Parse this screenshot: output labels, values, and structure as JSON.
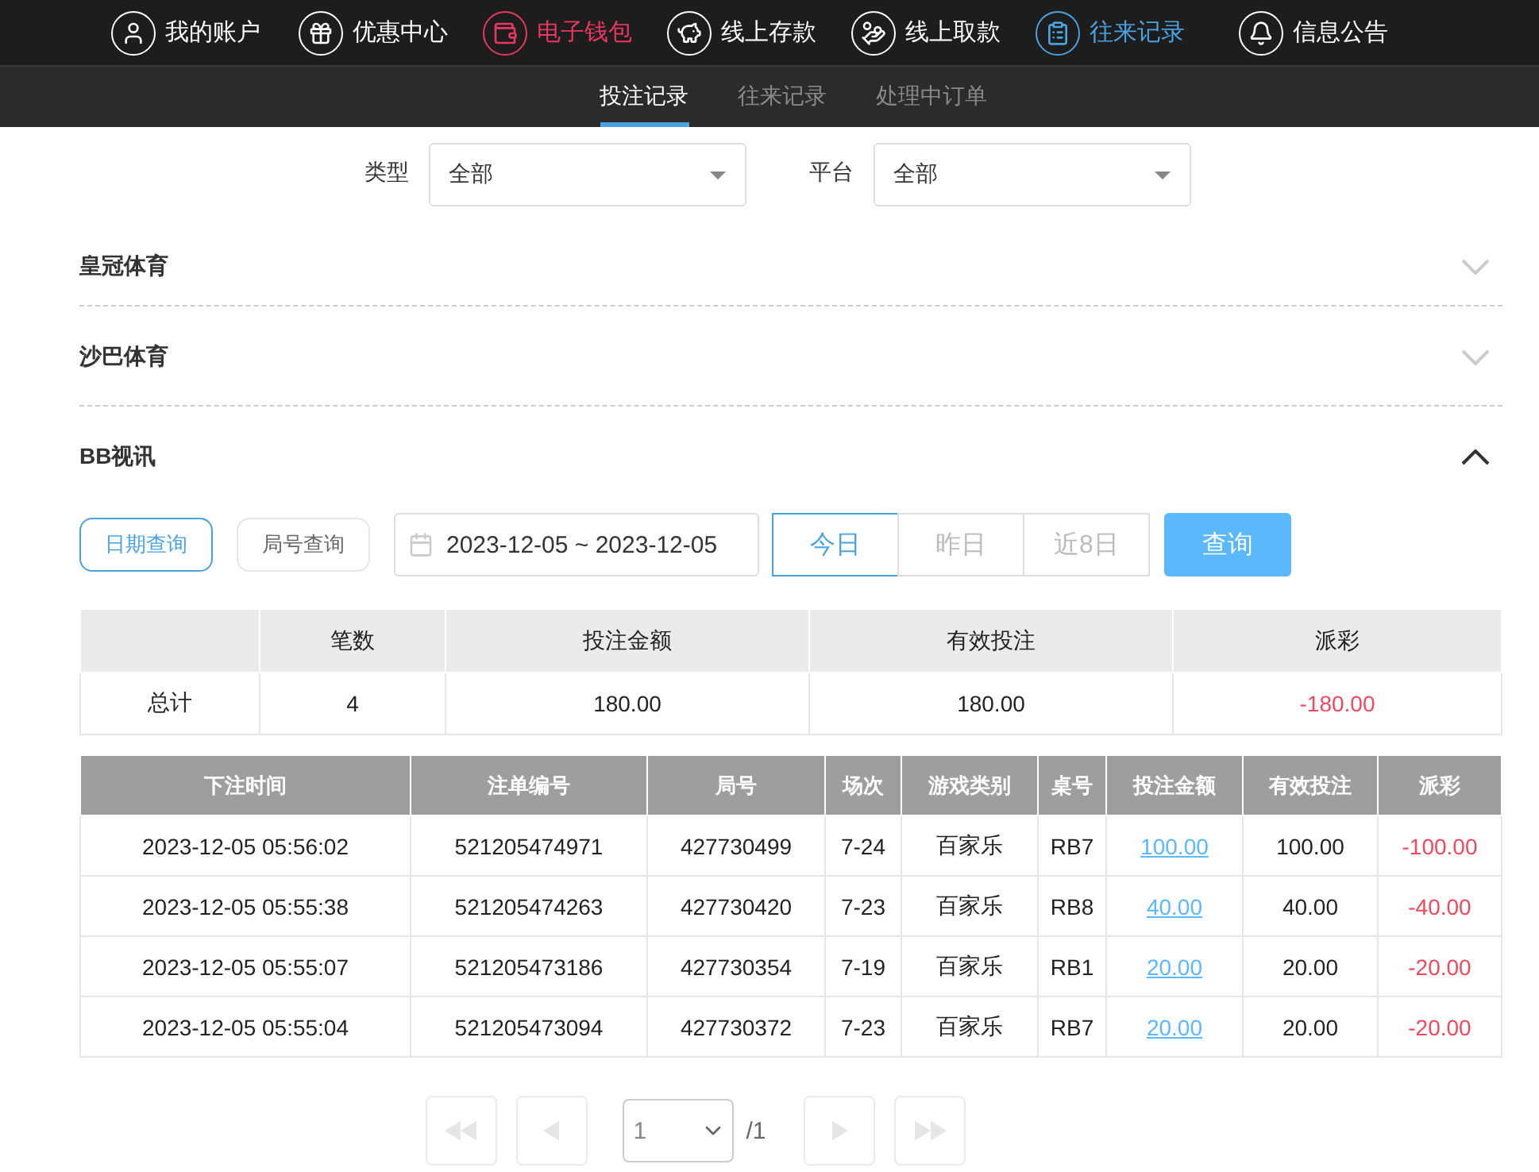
{
  "top_nav": [
    {
      "label": "我的账户",
      "selected": false,
      "highlighted": false
    },
    {
      "label": "优惠中心",
      "selected": false,
      "highlighted": false
    },
    {
      "label": "电子钱包",
      "selected": false,
      "highlighted": true
    },
    {
      "label": "线上存款",
      "selected": false,
      "highlighted": false
    },
    {
      "label": "线上取款",
      "selected": false,
      "highlighted": false
    },
    {
      "label": "往来记录",
      "selected": true,
      "highlighted": false
    },
    {
      "label": "信息公告",
      "selected": false,
      "highlighted": false
    }
  ],
  "sub_tabs": [
    {
      "label": "投注记录",
      "selected": true
    },
    {
      "label": "往来记录",
      "selected": false
    },
    {
      "label": "处理中订单",
      "selected": false
    }
  ],
  "filters": [
    {
      "label": "类型",
      "value": "全部"
    },
    {
      "label": "平台",
      "value": "全部"
    }
  ],
  "sections": [
    {
      "title": "皇冠体育",
      "expanded": false
    },
    {
      "title": "沙巴体育",
      "expanded": false
    },
    {
      "title": "BB视讯",
      "expanded": true
    }
  ],
  "query_modes": [
    {
      "label": "日期查询",
      "selected": true
    },
    {
      "label": "局号查询",
      "selected": false
    }
  ],
  "date_range": "2023-12-05 ~ 2023-12-05",
  "quick_ranges": [
    {
      "label": "今日",
      "selected": true
    },
    {
      "label": "昨日",
      "selected": false
    },
    {
      "label": "近8日",
      "selected": false
    }
  ],
  "search_button": "查询",
  "summary": {
    "columns": [
      "笔数",
      "投注金额",
      "有效投注",
      "派彩"
    ],
    "row_label": "总计",
    "values": [
      "4",
      "180.00",
      "180.00",
      "-180.00"
    ]
  },
  "table": {
    "columns": [
      "下注时间",
      "注单编号",
      "局号",
      "场次",
      "游戏类别",
      "桌号",
      "投注金额",
      "有效投注",
      "派彩"
    ],
    "rows": [
      [
        "2023-12-05 05:56:02",
        "521205474971",
        "427730499",
        "7-24",
        "百家乐",
        "RB7",
        "100.00",
        "100.00",
        "-100.00"
      ],
      [
        "2023-12-05 05:55:38",
        "521205474263",
        "427730420",
        "7-23",
        "百家乐",
        "RB8",
        "40.00",
        "40.00",
        "-40.00"
      ],
      [
        "2023-12-05 05:55:07",
        "521205473186",
        "427730354",
        "7-19",
        "百家乐",
        "RB1",
        "20.00",
        "20.00",
        "-20.00"
      ],
      [
        "2023-12-05 05:55:04",
        "521205473094",
        "427730372",
        "7-23",
        "百家乐",
        "RB7",
        "20.00",
        "20.00",
        "-20.00"
      ]
    ]
  },
  "pagination": {
    "page": "1",
    "total": "/1"
  }
}
